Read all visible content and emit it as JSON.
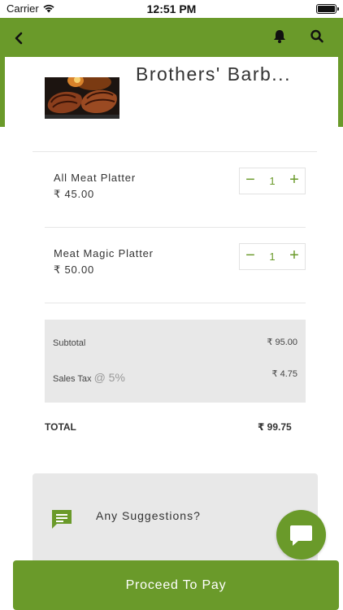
{
  "status_bar": {
    "carrier": "Carrier",
    "time": "12:51 PM",
    "icons": [
      "wifi-icon",
      "battery-icon"
    ]
  },
  "header": {
    "icons": [
      "chevron-left-icon",
      "bell-icon",
      "search-icon"
    ],
    "brand_color": "#6a9a2a"
  },
  "restaurant": {
    "name": "Brothers' Barb..."
  },
  "cart": {
    "currency_symbol": "₹",
    "items": [
      {
        "name": "All Meat Platter",
        "price": "₹ 45.00",
        "quantity": "1"
      },
      {
        "name": "Meat Magic Platter",
        "price": "₹ 50.00",
        "quantity": "1"
      }
    ]
  },
  "summary": {
    "subtotal_label": "Subtotal",
    "subtotal_value": "₹ 95.00",
    "tax_label": "Sales Tax",
    "tax_at": "@ 5%",
    "tax_value": "₹ 4.75",
    "total_label": "TOTAL",
    "total_value": "₹ 99.75"
  },
  "suggestions": {
    "label": "Any Suggestions?"
  },
  "chat": {
    "icon": "chat-bubble-icon"
  },
  "footer": {
    "proceed_label": "Proceed To Pay"
  }
}
